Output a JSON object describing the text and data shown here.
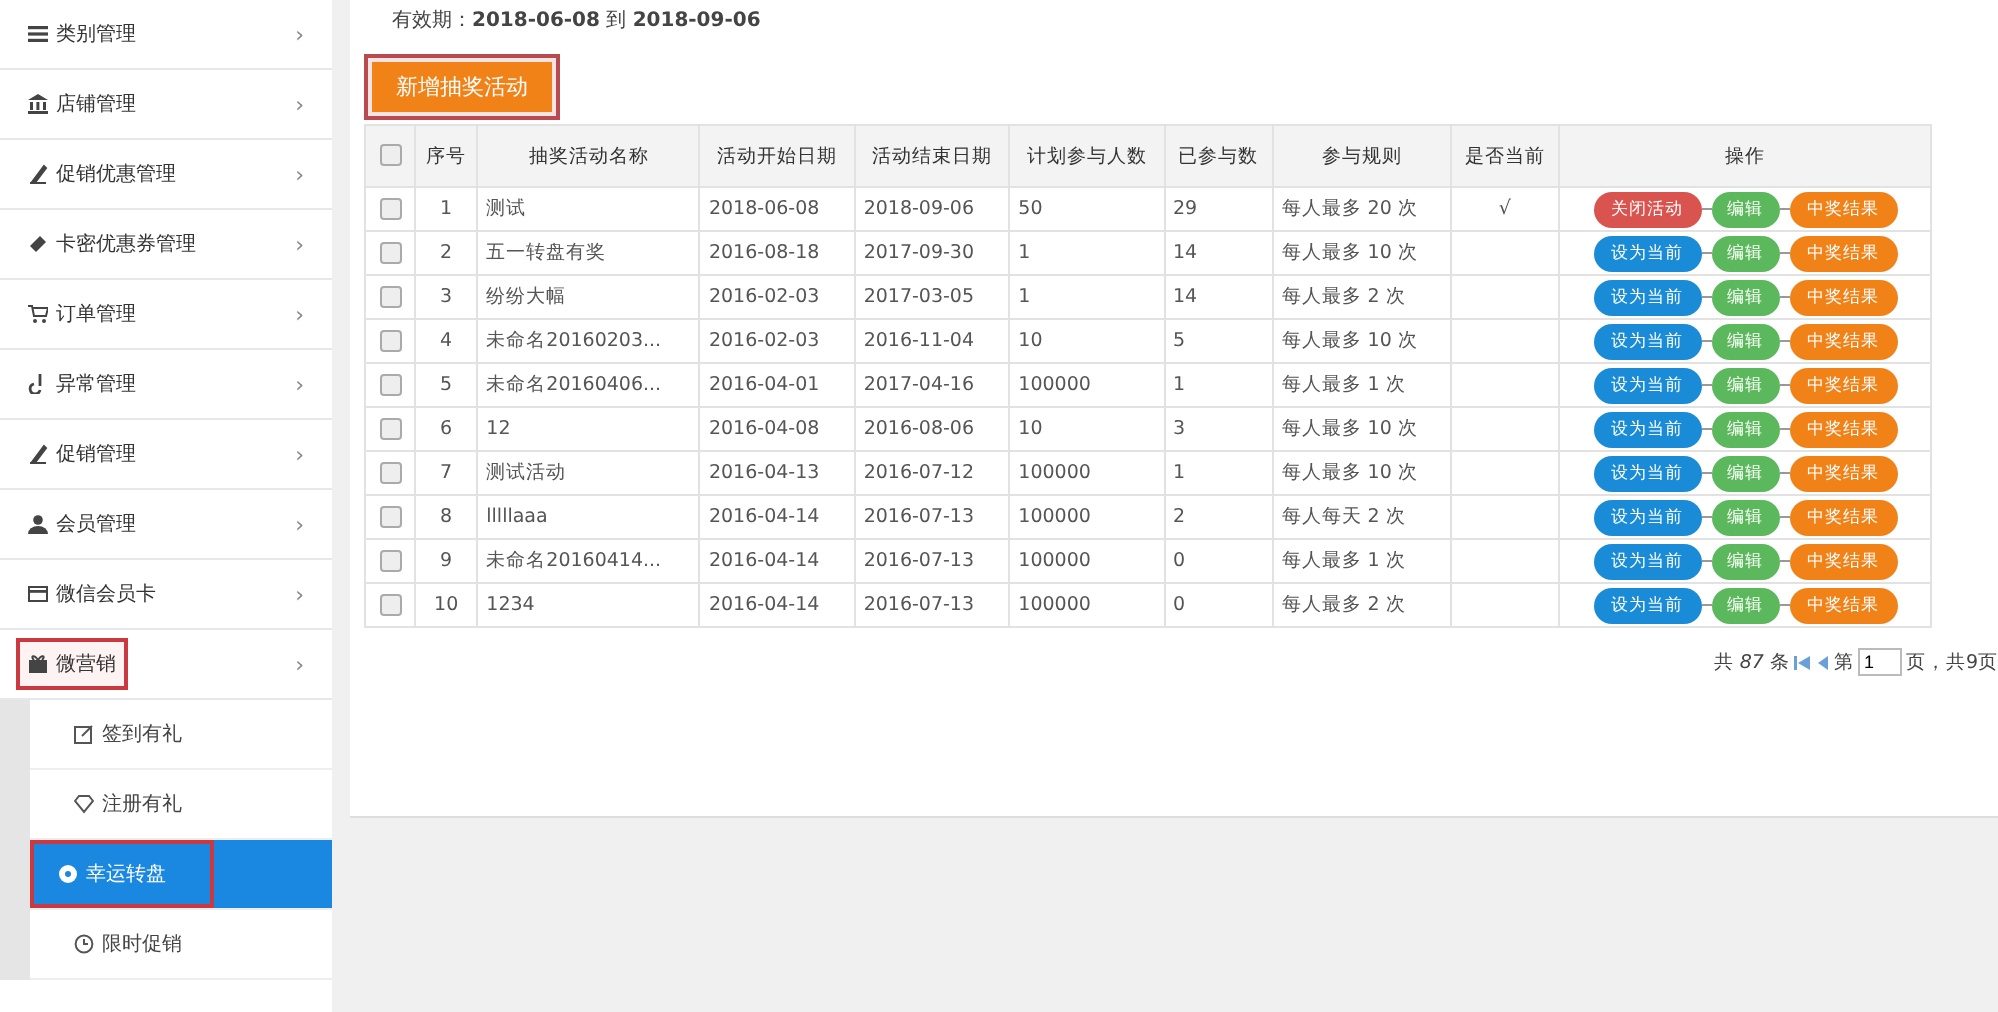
{
  "sidebar": {
    "items": [
      {
        "label": "类别管理",
        "chevron": "›"
      },
      {
        "label": "店铺管理",
        "chevron": "›"
      },
      {
        "label": "促销优惠管理",
        "chevron": "›"
      },
      {
        "label": "卡密优惠券管理",
        "chevron": "›"
      },
      {
        "label": "订单管理",
        "chevron": "›"
      },
      {
        "label": "异常管理",
        "chevron": "›"
      },
      {
        "label": "促销管理",
        "chevron": "›"
      },
      {
        "label": "会员管理",
        "chevron": "›"
      },
      {
        "label": "微信会员卡",
        "chevron": "›"
      },
      {
        "label": "微营销",
        "chevron": "›",
        "highlighted": true,
        "children": [
          {
            "label": "签到有礼",
            "selected": false
          },
          {
            "label": "注册有礼",
            "selected": false
          },
          {
            "label": "幸运转盘",
            "selected": true,
            "highlighted": true
          },
          {
            "label": "限时促销",
            "selected": false
          }
        ]
      }
    ]
  },
  "validity": "有效期：**2018-06-08** 到 **2018-09-06**",
  "add_button": {
    "label": "新增抽奖活动",
    "highlighted": true
  },
  "table": {
    "all_checked": false,
    "columns": [
      "序号",
      "抽奖活动名称",
      "活动开始日期",
      "活动结束日期",
      "计划参与人数",
      "已参与数",
      "参与规则",
      "是否当前",
      "操作"
    ],
    "rows": [
      {
        "checked": false,
        "index": "1",
        "name": "测试",
        "start": "2018-06-08",
        "end": "2018-09-06",
        "planned": "50",
        "joined": "29",
        "rule": "每人最多 20 次",
        "current": "√",
        "actions": [
          {
            "kind": "close",
            "label": "关闭活动"
          },
          {
            "kind": "edit",
            "label": "编辑"
          },
          {
            "kind": "results",
            "label": "中奖结果"
          }
        ]
      },
      {
        "checked": false,
        "index": "2",
        "name": "五一转盘有奖",
        "start": "2016-08-18",
        "end": "2017-09-30",
        "planned": "1",
        "joined": "14",
        "rule": "每人最多 10 次",
        "actions": [
          {
            "kind": "set_current",
            "label": "设为当前"
          },
          {
            "kind": "edit",
            "label": "编辑"
          },
          {
            "kind": "results",
            "label": "中奖结果"
          }
        ]
      },
      {
        "checked": false,
        "index": "3",
        "name": "纷纷大幅",
        "start": "2016-02-03",
        "end": "2017-03-05",
        "planned": "1",
        "joined": "14",
        "rule": "每人最多 2 次",
        "actions": [
          {
            "kind": "set_current",
            "label": "设为当前"
          },
          {
            "kind": "edit",
            "label": "编辑"
          },
          {
            "kind": "results",
            "label": "中奖结果"
          }
        ]
      },
      {
        "checked": false,
        "index": "4",
        "name": "未命名20160203...",
        "start": "2016-02-03",
        "end": "2016-11-04",
        "planned": "10",
        "joined": "5",
        "rule": "每人最多 10 次",
        "actions": [
          {
            "kind": "set_current",
            "label": "设为当前"
          },
          {
            "kind": "edit",
            "label": "编辑"
          },
          {
            "kind": "results",
            "label": "中奖结果"
          }
        ]
      },
      {
        "checked": false,
        "index": "5",
        "name": "未命名20160406...",
        "start": "2016-04-01",
        "end": "2017-04-16",
        "planned": "100000",
        "joined": "1",
        "rule": "每人最多 1 次",
        "actions": [
          {
            "kind": "set_current",
            "label": "设为当前"
          },
          {
            "kind": "edit",
            "label": "编辑"
          },
          {
            "kind": "results",
            "label": "中奖结果"
          }
        ]
      },
      {
        "checked": false,
        "index": "6",
        "name": "12",
        "start": "2016-04-08",
        "end": "2016-08-06",
        "planned": "10",
        "joined": "3",
        "rule": "每人最多 10 次",
        "actions": [
          {
            "kind": "set_current",
            "label": "设为当前"
          },
          {
            "kind": "edit",
            "label": "编辑"
          },
          {
            "kind": "results",
            "label": "中奖结果"
          }
        ]
      },
      {
        "checked": false,
        "index": "7",
        "name": "测试活动",
        "start": "2016-04-13",
        "end": "2016-07-12",
        "planned": "100000",
        "joined": "1",
        "rule": "每人最多 10 次",
        "actions": [
          {
            "kind": "set_current",
            "label": "设为当前"
          },
          {
            "kind": "edit",
            "label": "编辑"
          },
          {
            "kind": "results",
            "label": "中奖结果"
          }
        ]
      },
      {
        "checked": false,
        "index": "8",
        "name": "lllllaaa",
        "start": "2016-04-14",
        "end": "2016-07-13",
        "planned": "100000",
        "joined": "2",
        "rule": "每人每天 2 次",
        "actions": [
          {
            "kind": "set_current",
            "label": "设为当前"
          },
          {
            "kind": "edit",
            "label": "编辑"
          },
          {
            "kind": "results",
            "label": "中奖结果"
          }
        ]
      },
      {
        "checked": false,
        "index": "9",
        "name": "未命名20160414...",
        "start": "2016-04-14",
        "end": "2016-07-13",
        "planned": "100000",
        "joined": "0",
        "rule": "每人最多 1 次",
        "actions": [
          {
            "kind": "set_current",
            "label": "设为当前"
          },
          {
            "kind": "edit",
            "label": "编辑"
          },
          {
            "kind": "results",
            "label": "中奖结果"
          }
        ]
      },
      {
        "checked": false,
        "index": "10",
        "name": "1234",
        "start": "2016-04-14",
        "end": "2016-07-13",
        "planned": "100000",
        "joined": "0",
        "rule": "每人最多 2 次",
        "actions": [
          {
            "kind": "set_current",
            "label": "设为当前"
          },
          {
            "kind": "edit",
            "label": "编辑"
          },
          {
            "kind": "results",
            "label": "中奖结果"
          }
        ]
      }
    ]
  },
  "pagination": {
    "total_prefix": "共",
    "total": "87",
    "total_suffix": "条",
    "page_prefix": "第",
    "page": "1",
    "page_suffix": "页，共9页"
  }
}
